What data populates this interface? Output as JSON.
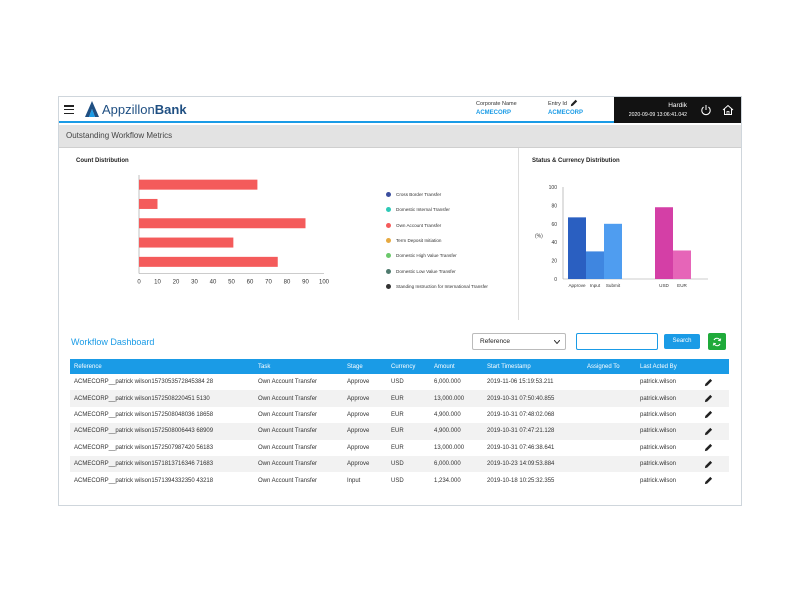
{
  "header": {
    "brand_light": "Appzillon",
    "brand_bold": "Bank",
    "corporate_label": "Corporate Name",
    "corporate_value": "ACMECORP",
    "entity_label": "Entry Id",
    "entity_value": "ACMECORP",
    "user_name": "Hardik",
    "timestamp": "2020-09-09 13:06:41.042"
  },
  "section_title": "Outstanding Workflow Metrics",
  "count_chart": {
    "title": "Count Distribution",
    "chart_data": {
      "type": "bar",
      "orientation": "horizontal",
      "categories": [
        "Cross Border Transfer",
        "Domestic Internal Transfer",
        "Own Account Transfer",
        "Term Deposit Initiation",
        "Domestic High Value Transfer",
        "Domestic Low Value Transfer",
        "Standing Instruction for International Transfer"
      ],
      "values": [
        64,
        10,
        90,
        51,
        75
      ],
      "xlim": [
        0,
        100
      ],
      "xticks": [
        "0",
        "10",
        "20",
        "30",
        "40",
        "50",
        "60",
        "70",
        "80",
        "90",
        "100"
      ],
      "bar_color": "#f45b5b",
      "legend_position": "right",
      "legend_colors": [
        "#3b4e9e",
        "#2ec9b7",
        "#f45b5b",
        "#e6a940",
        "#6bc86b",
        "#4f7a6e",
        "#333333"
      ]
    }
  },
  "status_chart": {
    "title": "Status & Currency Distribution",
    "chart_data": {
      "type": "bar",
      "ylabel": "(%)",
      "ylim": [
        0,
        100
      ],
      "yticks": [
        "0",
        "10",
        "20",
        "30",
        "40",
        "50",
        "60",
        "70",
        "80",
        "90",
        "100"
      ],
      "groups": [
        {
          "categories": [
            "Approve",
            "Input",
            "Submit"
          ],
          "values": [
            67,
            30,
            60
          ],
          "colors": [
            "#2a5fc1",
            "#3f86e0",
            "#4f9df0"
          ]
        },
        {
          "categories": [
            "USD",
            "EUR"
          ],
          "values": [
            78,
            31
          ],
          "colors": [
            "#d43fa6",
            "#e665b8"
          ]
        }
      ],
      "grid": false
    }
  },
  "workflow": {
    "title": "Workflow Dashboard",
    "select_value": "Reference",
    "search_value": "",
    "search_label": "Search",
    "columns": [
      "Reference",
      "Task",
      "Stage",
      "Currency",
      "Amount",
      "Start Timestamp",
      "Assigned To",
      "Last Acted By",
      ""
    ],
    "rows": [
      [
        "ACMECORP__patrick wilson1573053572845384 28",
        "Own Account Transfer",
        "Approve",
        "USD",
        "6,000.000",
        "2019-11-06 15:19:53.211",
        "",
        "patrick.wilson"
      ],
      [
        "ACMECORP__patrick wilson1572508220451 5130",
        "Own Account Transfer",
        "Approve",
        "EUR",
        "13,000.000",
        "2019-10-31 07:50:40.855",
        "",
        "patrick.wilson"
      ],
      [
        "ACMECORP__patrick wilson1572508048036 18658",
        "Own Account Transfer",
        "Approve",
        "EUR",
        "4,900.000",
        "2019-10-31 07:48:02.068",
        "",
        "patrick.wilson"
      ],
      [
        "ACMECORP__patrick wilson1572508006443 68909",
        "Own Account Transfer",
        "Approve",
        "EUR",
        "4,900.000",
        "2019-10-31 07:47:21.128",
        "",
        "patrick.wilson"
      ],
      [
        "ACMECORP__patrick wilson1572507987420 56183",
        "Own Account Transfer",
        "Approve",
        "EUR",
        "13,000.000",
        "2019-10-31 07:46:38.641",
        "",
        "patrick.wilson"
      ],
      [
        "ACMECORP__patrick wilson1571813716346 71683",
        "Own Account Transfer",
        "Approve",
        "USD",
        "6,000.000",
        "2019-10-23 14:09:53.884",
        "",
        "patrick.wilson"
      ],
      [
        "ACMECORP__patrick wilson1571394332350 43218",
        "Own Account Transfer",
        "Input",
        "USD",
        "1,234.000",
        "2019-10-18 10:25:32.355",
        "",
        "patrick.wilson"
      ]
    ]
  }
}
